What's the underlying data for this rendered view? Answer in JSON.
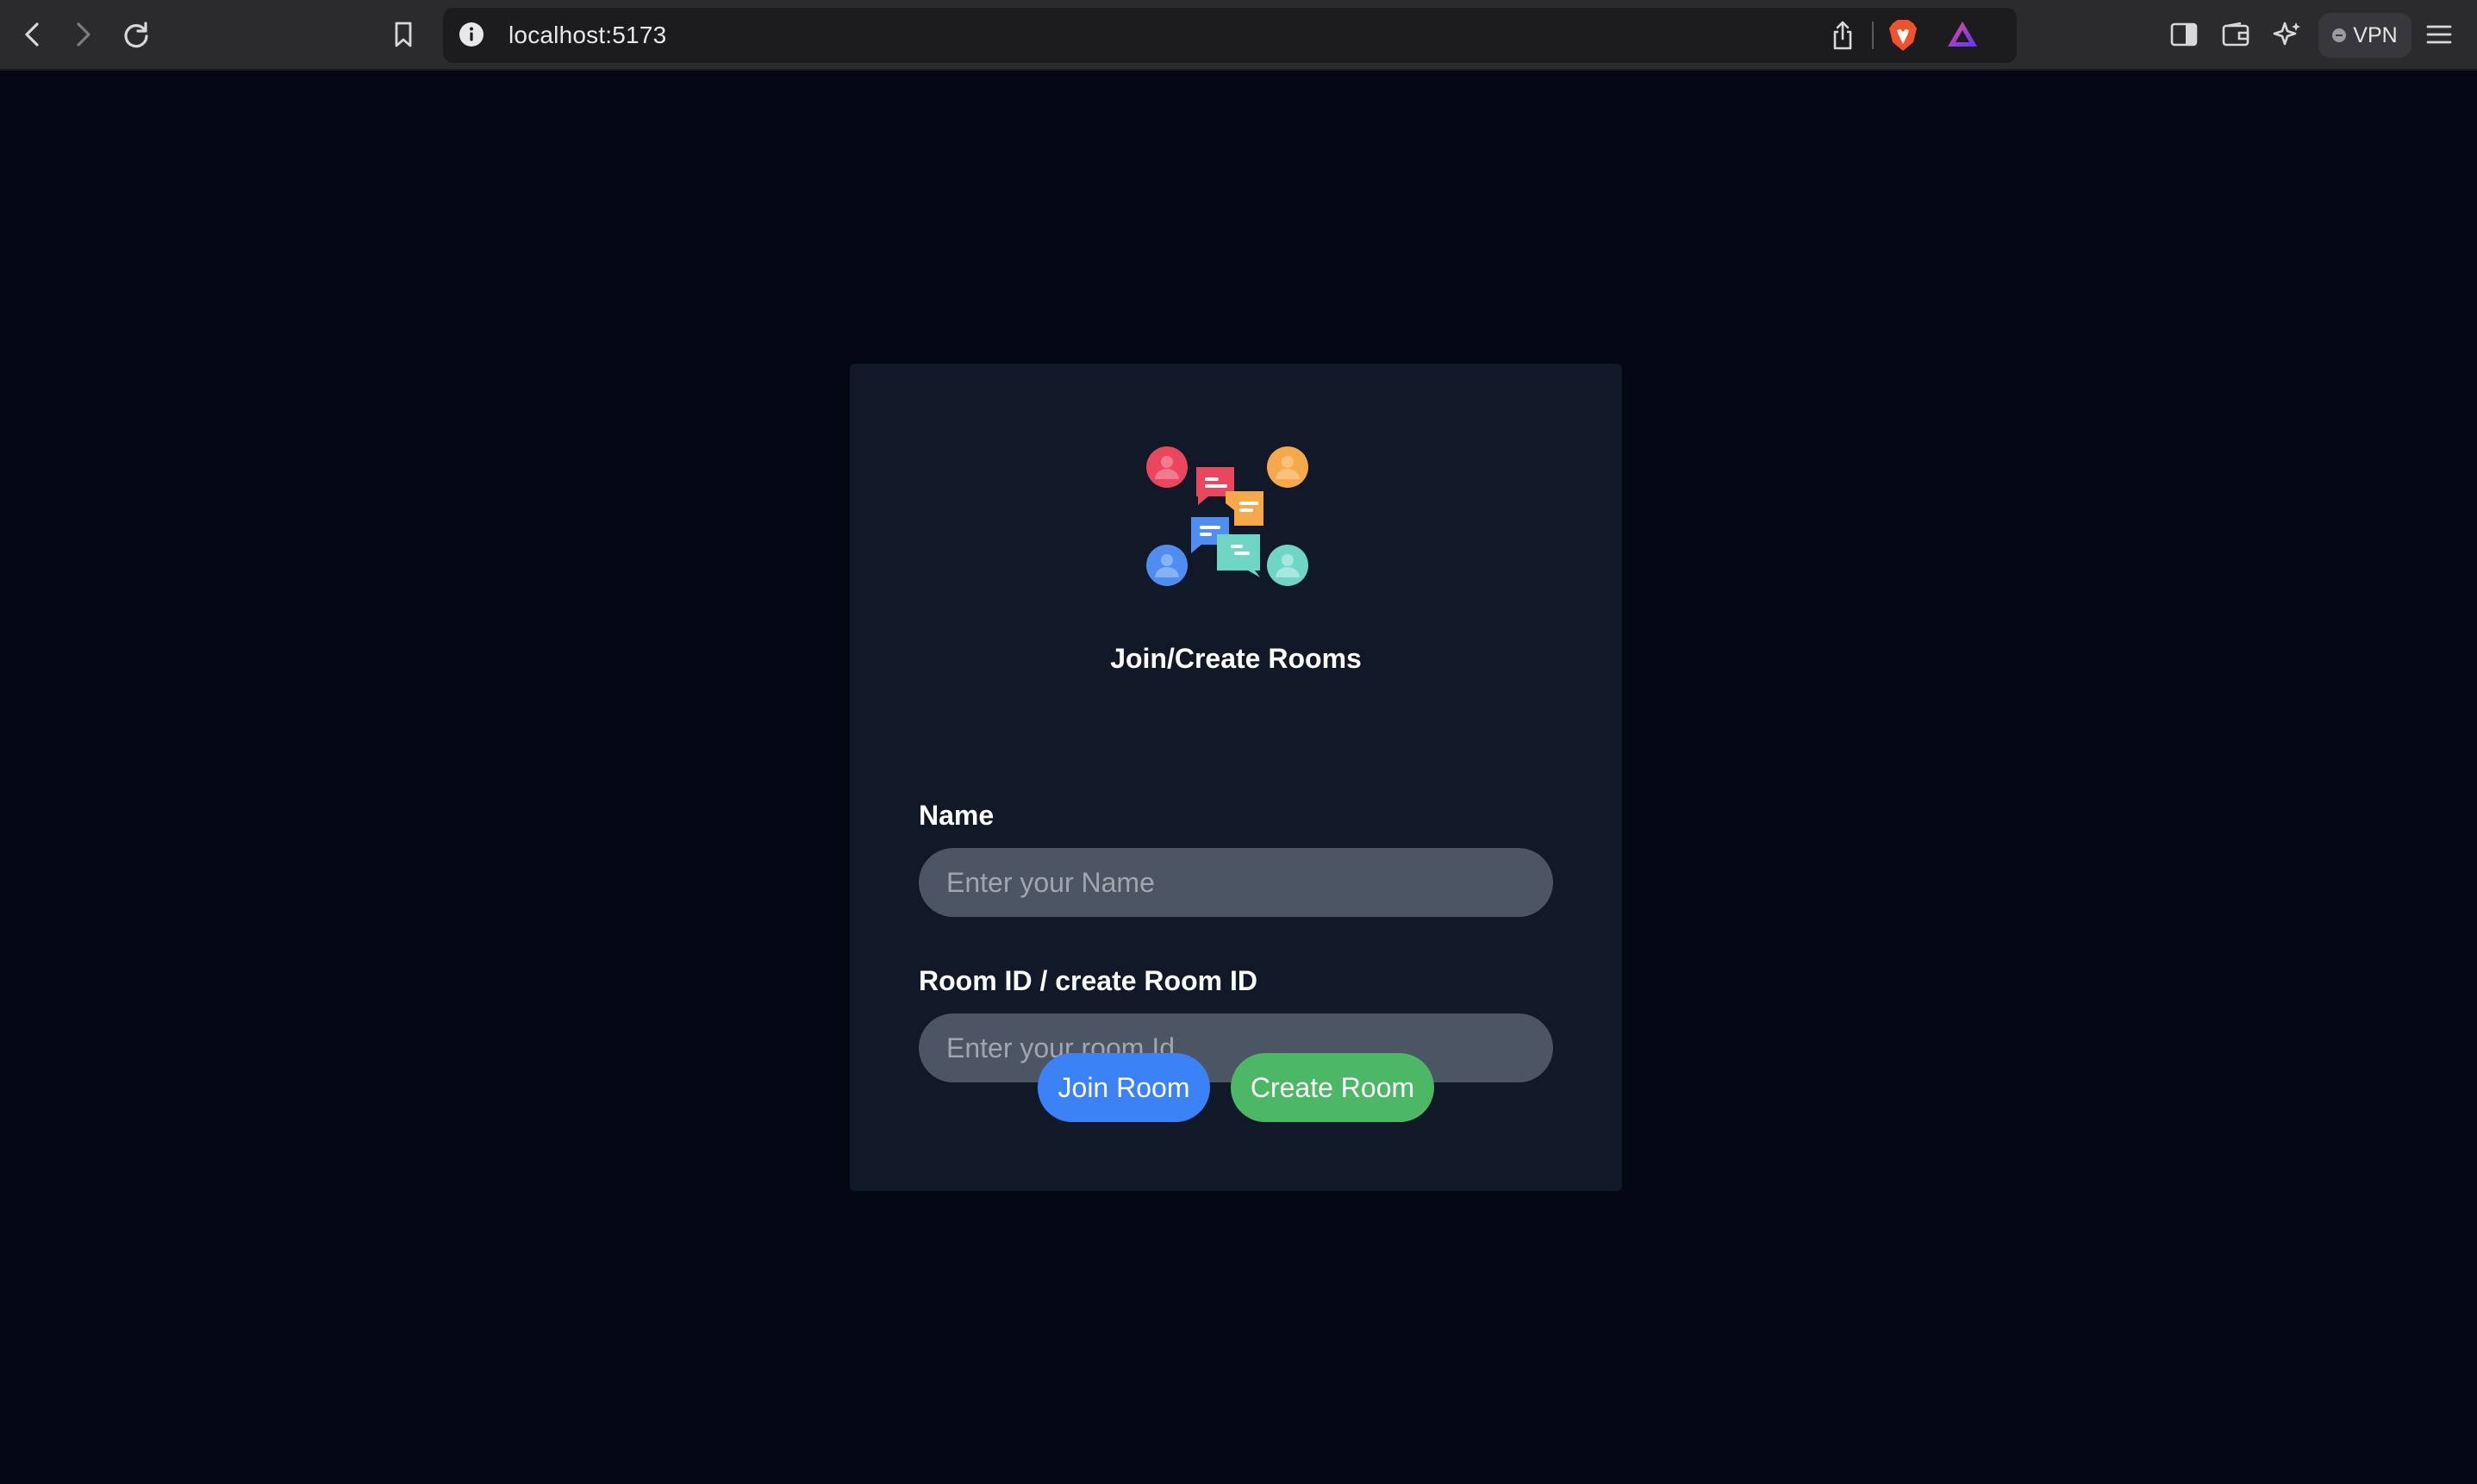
{
  "browser": {
    "url": "localhost:5173",
    "vpn_label": "VPN"
  },
  "icons": {
    "back": "chevron-left-icon",
    "forward": "chevron-right-icon",
    "reload": "reload-icon",
    "bookmark": "bookmark-icon",
    "site_info": "info-icon",
    "share": "share-icon",
    "brave_shields": "brave-lion-icon",
    "brave_rewards": "triangle-rewards-icon",
    "sidebar": "sidebar-toggle-icon",
    "wallet": "wallet-icon",
    "leo": "sparkle-ai-icon",
    "menu": "hamburger-menu-icon",
    "logo": "chat-people-logo-icon"
  },
  "colors": {
    "page_background": "#050814",
    "card_background": "#111827",
    "input_background": "#4b5563",
    "join_button": "#3b82f6",
    "create_button": "#4cb865"
  },
  "form": {
    "title": "Join/Create Rooms",
    "name_label": "Name",
    "name_placeholder": "Enter your Name",
    "name_value": "",
    "room_label": "Room ID / create Room ID",
    "room_placeholder": "Enter your room Id",
    "room_value": "",
    "join_button": "Join Room",
    "create_button": "Create Room"
  }
}
